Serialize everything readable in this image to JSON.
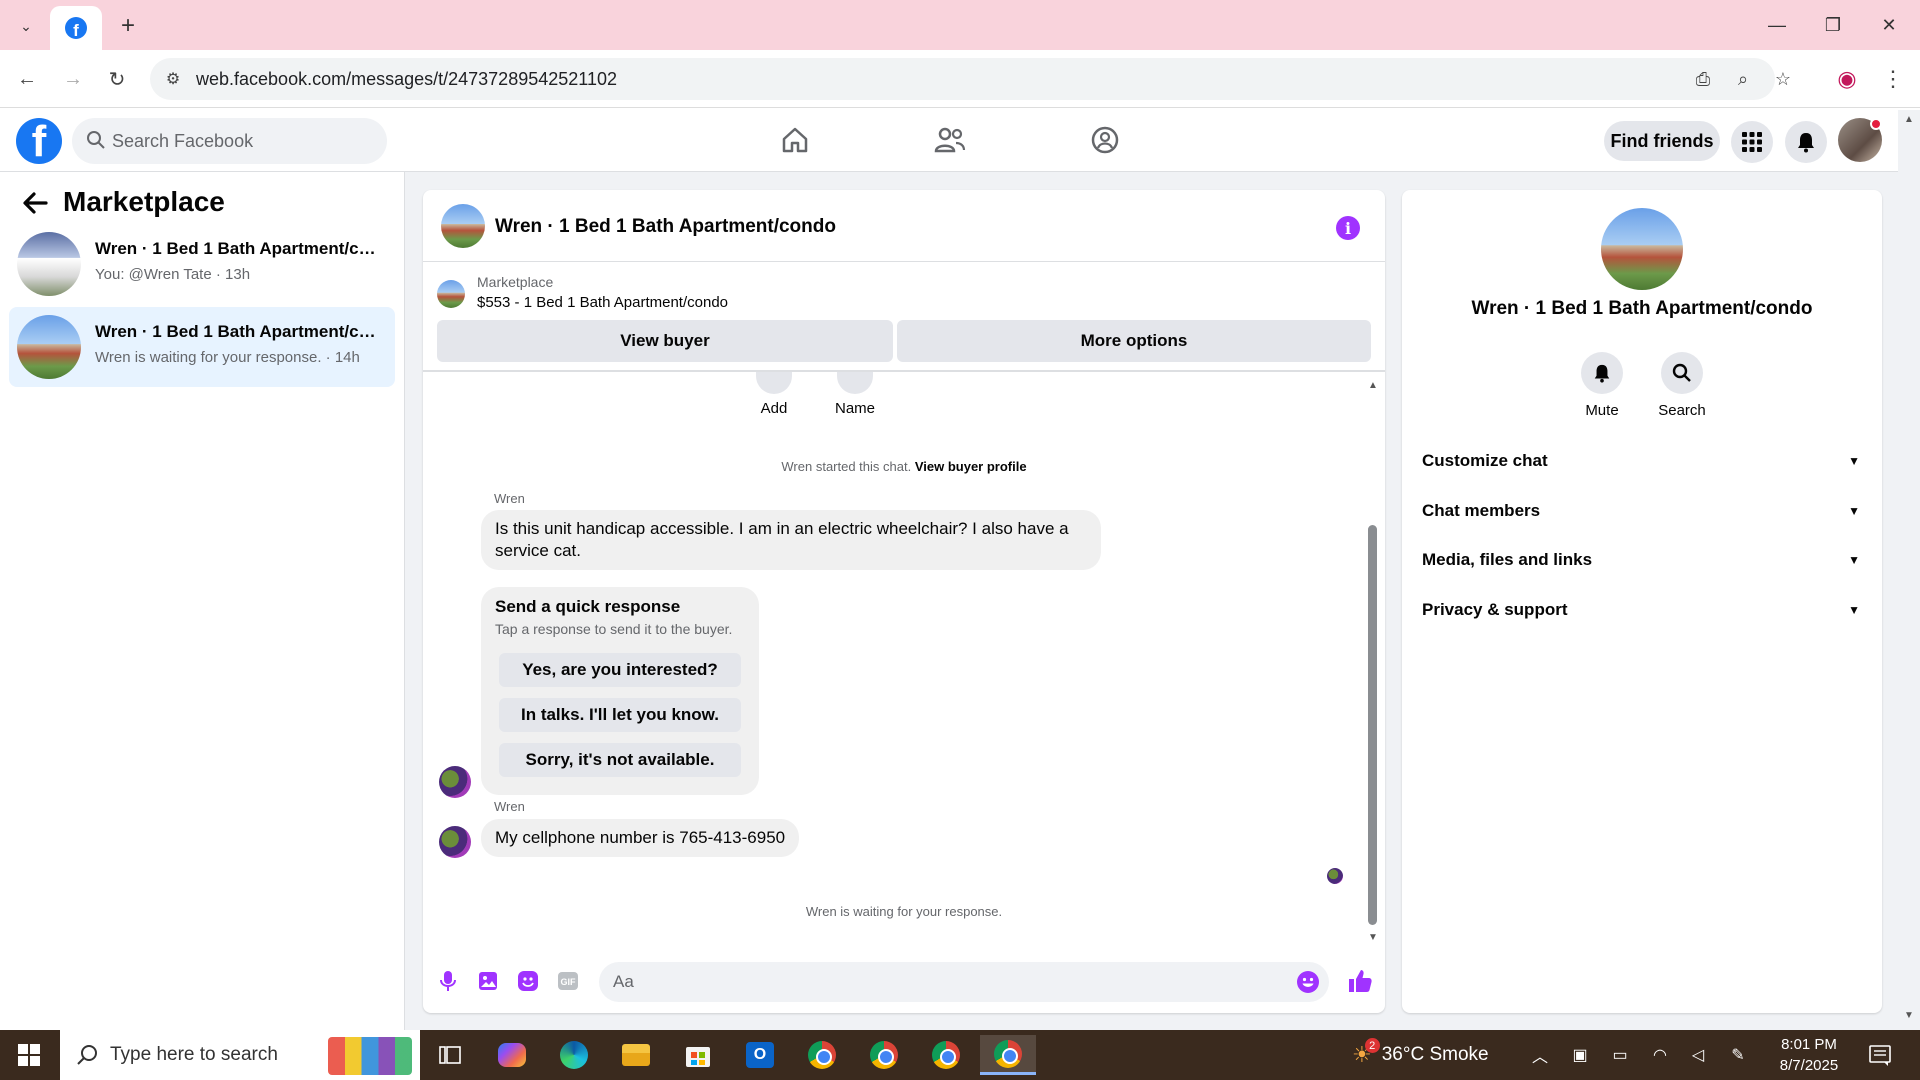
{
  "browser": {
    "url": "web.facebook.com/messages/t/24737289542521102",
    "tab_title": "Facebook"
  },
  "header": {
    "search_placeholder": "Search Facebook",
    "find_friends_label": "Find friends"
  },
  "sidebar": {
    "title": "Marketplace",
    "conversations": [
      {
        "name": "Wren · 1 Bed 1 Bath Apartment/condo",
        "snippet": "You: @Wren Tate · 13h",
        "active": false
      },
      {
        "name": "Wren · 1 Bed 1 Bath Apartment/condo",
        "snippet": "Wren is waiting for your response. · 14h",
        "active": true
      }
    ]
  },
  "chat": {
    "title": "Wren · 1 Bed 1 Bath Apartment/condo",
    "marketplace_label": "Marketplace",
    "listing": "$553 - 1 Bed 1 Bath Apartment/condo",
    "view_buyer_label": "View buyer",
    "more_options_label": "More options",
    "mini_actions": [
      "Add",
      "Name"
    ],
    "started_text": "Wren started this chat.",
    "view_buyer_profile": "View buyer profile",
    "messages": [
      {
        "sender": "Wren",
        "text": "Is this unit handicap accessible.  I am in an electric wheelchair? I also have a service cat."
      },
      {
        "sender": "Wren",
        "text": "My cellphone number is 765-413-6950"
      }
    ],
    "quick_response": {
      "heading": "Send a quick response",
      "subheading": "Tap a response to send it to the buyer.",
      "options": [
        "Yes, are you interested?",
        "In talks. I'll let you know.",
        "Sorry, it's not available."
      ]
    },
    "waiting_text": "Wren is waiting for your response.",
    "composer_placeholder": "Aa"
  },
  "info_panel": {
    "name": "Wren · 1 Bed 1 Bath Apartment/condo",
    "actions": [
      "Mute",
      "Search"
    ],
    "sections": [
      "Customize chat",
      "Chat members",
      "Media, files and links",
      "Privacy & support"
    ]
  },
  "taskbar": {
    "search_placeholder": "Type here to search",
    "weather": "36°C  Smoke",
    "weather_badge": "2",
    "time": "8:01 PM",
    "date": "8/7/2025"
  },
  "colors": {
    "fb_blue": "#1877f2",
    "messenger_purple": "#a033ff",
    "active_conv_bg": "#e7f3ff"
  }
}
